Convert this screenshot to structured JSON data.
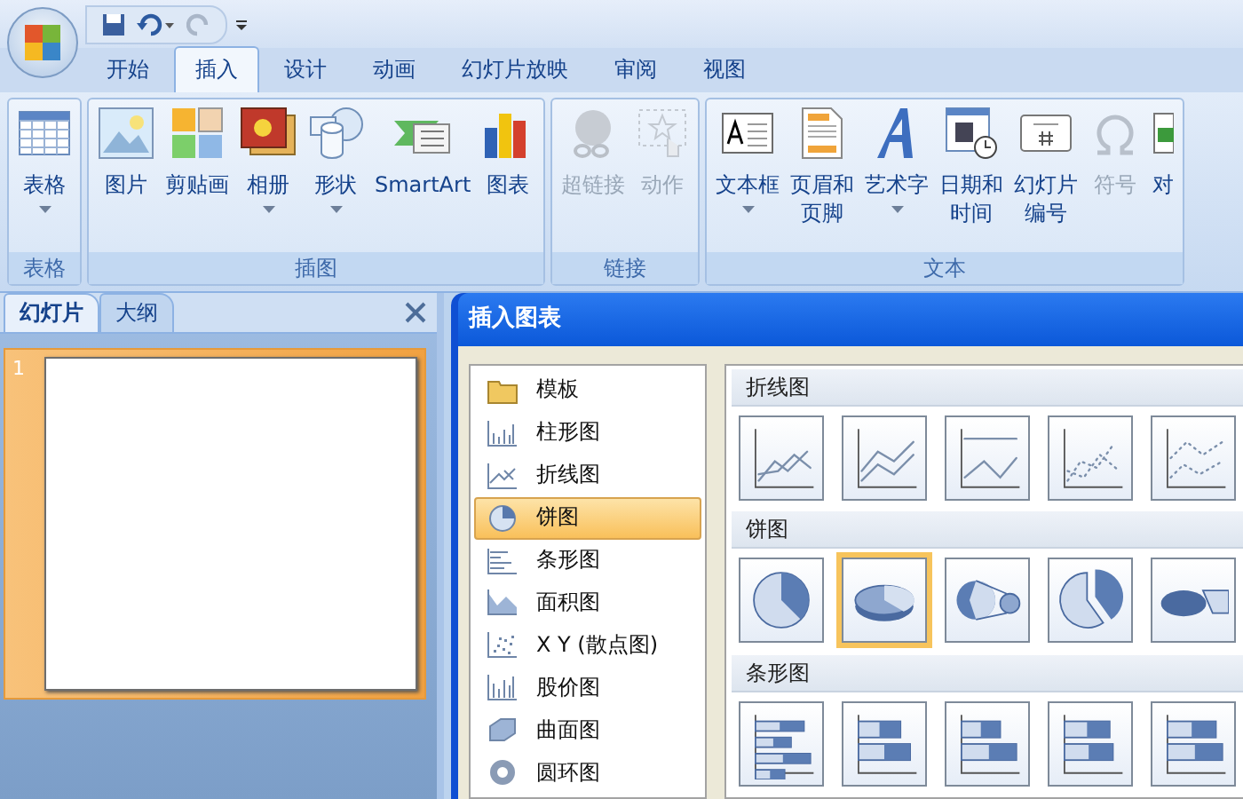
{
  "quick_access": {
    "office_button": true
  },
  "tabs": [
    {
      "label": "开始",
      "selected": false
    },
    {
      "label": "插入",
      "selected": true
    },
    {
      "label": "设计",
      "selected": false
    },
    {
      "label": "动画",
      "selected": false
    },
    {
      "label": "幻灯片放映",
      "selected": false
    },
    {
      "label": "审阅",
      "selected": false
    },
    {
      "label": "视图",
      "selected": false
    }
  ],
  "ribbon_groups": [
    {
      "label": "表格",
      "buttons": [
        {
          "kind": "table",
          "lines": [
            "表格"
          ],
          "dropdown": true,
          "disabled": false
        }
      ]
    },
    {
      "label": "插图",
      "buttons": [
        {
          "kind": "picture",
          "lines": [
            "图片"
          ],
          "dropdown": false,
          "disabled": false
        },
        {
          "kind": "clipart",
          "lines": [
            "剪贴画"
          ],
          "dropdown": false,
          "disabled": false
        },
        {
          "kind": "album",
          "lines": [
            "相册"
          ],
          "dropdown": true,
          "disabled": false
        },
        {
          "kind": "shapes",
          "lines": [
            "形状"
          ],
          "dropdown": true,
          "disabled": false
        },
        {
          "kind": "smartart",
          "lines": [
            "SmartArt"
          ],
          "dropdown": false,
          "disabled": false
        },
        {
          "kind": "chart",
          "lines": [
            "图表"
          ],
          "dropdown": false,
          "disabled": false
        }
      ]
    },
    {
      "label": "链接",
      "buttons": [
        {
          "kind": "hyperlink",
          "lines": [
            "超链接"
          ],
          "dropdown": false,
          "disabled": true
        },
        {
          "kind": "action",
          "lines": [
            "动作"
          ],
          "dropdown": false,
          "disabled": true
        }
      ]
    },
    {
      "label": "文本",
      "buttons": [
        {
          "kind": "textbox",
          "lines": [
            "文本框"
          ],
          "dropdown": true,
          "disabled": false
        },
        {
          "kind": "header",
          "lines": [
            "页眉和",
            "页脚"
          ],
          "dropdown": false,
          "disabled": false
        },
        {
          "kind": "wordart",
          "lines": [
            "艺术字"
          ],
          "dropdown": true,
          "disabled": false
        },
        {
          "kind": "datetime",
          "lines": [
            "日期和",
            "时间"
          ],
          "dropdown": false,
          "disabled": false
        },
        {
          "kind": "slidenumber",
          "lines": [
            "幻灯片",
            "编号"
          ],
          "dropdown": false,
          "disabled": false
        },
        {
          "kind": "symbol",
          "lines": [
            "符号"
          ],
          "dropdown": false,
          "disabled": true
        },
        {
          "kind": "object",
          "lines": [
            "对"
          ],
          "dropdown": false,
          "disabled": false
        }
      ]
    }
  ],
  "left_panel": {
    "tabs": [
      {
        "label": "幻灯片",
        "selected": true
      },
      {
        "label": "大纲",
        "selected": false
      }
    ],
    "slides": [
      {
        "number": "1",
        "selected": true
      }
    ]
  },
  "dialog": {
    "title": "插入图表",
    "categories": [
      {
        "kind": "template",
        "label": "模板",
        "selected": false
      },
      {
        "kind": "column",
        "label": "柱形图",
        "selected": false
      },
      {
        "kind": "line",
        "label": "折线图",
        "selected": false
      },
      {
        "kind": "pie",
        "label": "饼图",
        "selected": true
      },
      {
        "kind": "bar",
        "label": "条形图",
        "selected": false
      },
      {
        "kind": "area",
        "label": "面积图",
        "selected": false
      },
      {
        "kind": "scatter",
        "label": "X Y (散点图)",
        "selected": false
      },
      {
        "kind": "stock",
        "label": "股价图",
        "selected": false
      },
      {
        "kind": "surface",
        "label": "曲面图",
        "selected": false
      },
      {
        "kind": "doughnut",
        "label": "圆环图",
        "selected": false
      }
    ],
    "sections": [
      {
        "kind": "line",
        "title": "折线图",
        "thumbs": [
          {
            "selected": false
          },
          {
            "selected": false
          },
          {
            "selected": false
          },
          {
            "selected": false
          },
          {
            "selected": false
          }
        ]
      },
      {
        "kind": "pie",
        "title": "饼图",
        "thumbs": [
          {
            "selected": false
          },
          {
            "selected": true
          },
          {
            "selected": false
          },
          {
            "selected": false
          },
          {
            "selected": false
          }
        ]
      },
      {
        "kind": "bar",
        "title": "条形图",
        "thumbs": [
          {
            "selected": false
          },
          {
            "selected": false
          },
          {
            "selected": false
          },
          {
            "selected": false
          },
          {
            "selected": false
          }
        ]
      }
    ]
  }
}
